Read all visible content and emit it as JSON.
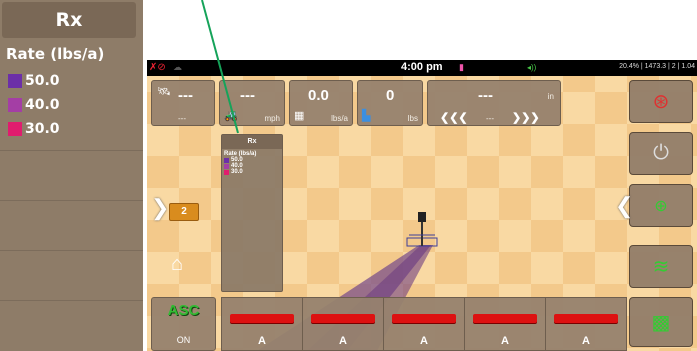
{
  "zoom_legend": {
    "title": "Rx",
    "subtitle": "Rate (lbs/a)",
    "items": [
      {
        "value": "50.0",
        "color": "#6c2fa8"
      },
      {
        "value": "40.0",
        "color": "#a43ea5"
      },
      {
        "value": "30.0",
        "color": "#e01c6e"
      }
    ]
  },
  "status_bar": {
    "time": "4:00 pm",
    "right_text": "20.4% | 1473.3 | 2 | 1.04"
  },
  "tiles": {
    "gps": {
      "value": "---",
      "unit": "---"
    },
    "speed": {
      "value": "---",
      "unit": "mph"
    },
    "rate": {
      "value": "0.0",
      "unit": "lbs/a"
    },
    "total": {
      "value": "0",
      "unit": "lbs"
    },
    "guidance": {
      "value": "---",
      "unit": "in",
      "offset": "---"
    }
  },
  "legend_box": {
    "title": "Rx",
    "subtitle": "Rate (lbs/a)",
    "items": [
      {
        "value": "50.0",
        "color": "#6c2fa8"
      },
      {
        "value": "40.0",
        "color": "#a43ea5"
      },
      {
        "value": "30.0",
        "color": "#e01c6e"
      }
    ]
  },
  "left_controls": {
    "camera_label": "2"
  },
  "asc": {
    "label": "ASC",
    "state": "ON"
  },
  "sections": [
    {
      "state": "A"
    },
    {
      "state": "A"
    },
    {
      "state": "A"
    },
    {
      "state": "A"
    },
    {
      "state": "A"
    }
  ],
  "right_buttons": [
    "steering-wheel-icon",
    "joystick-icon",
    "guidance-pattern-icon",
    "heat-wave-icon",
    "field-map-icon"
  ]
}
